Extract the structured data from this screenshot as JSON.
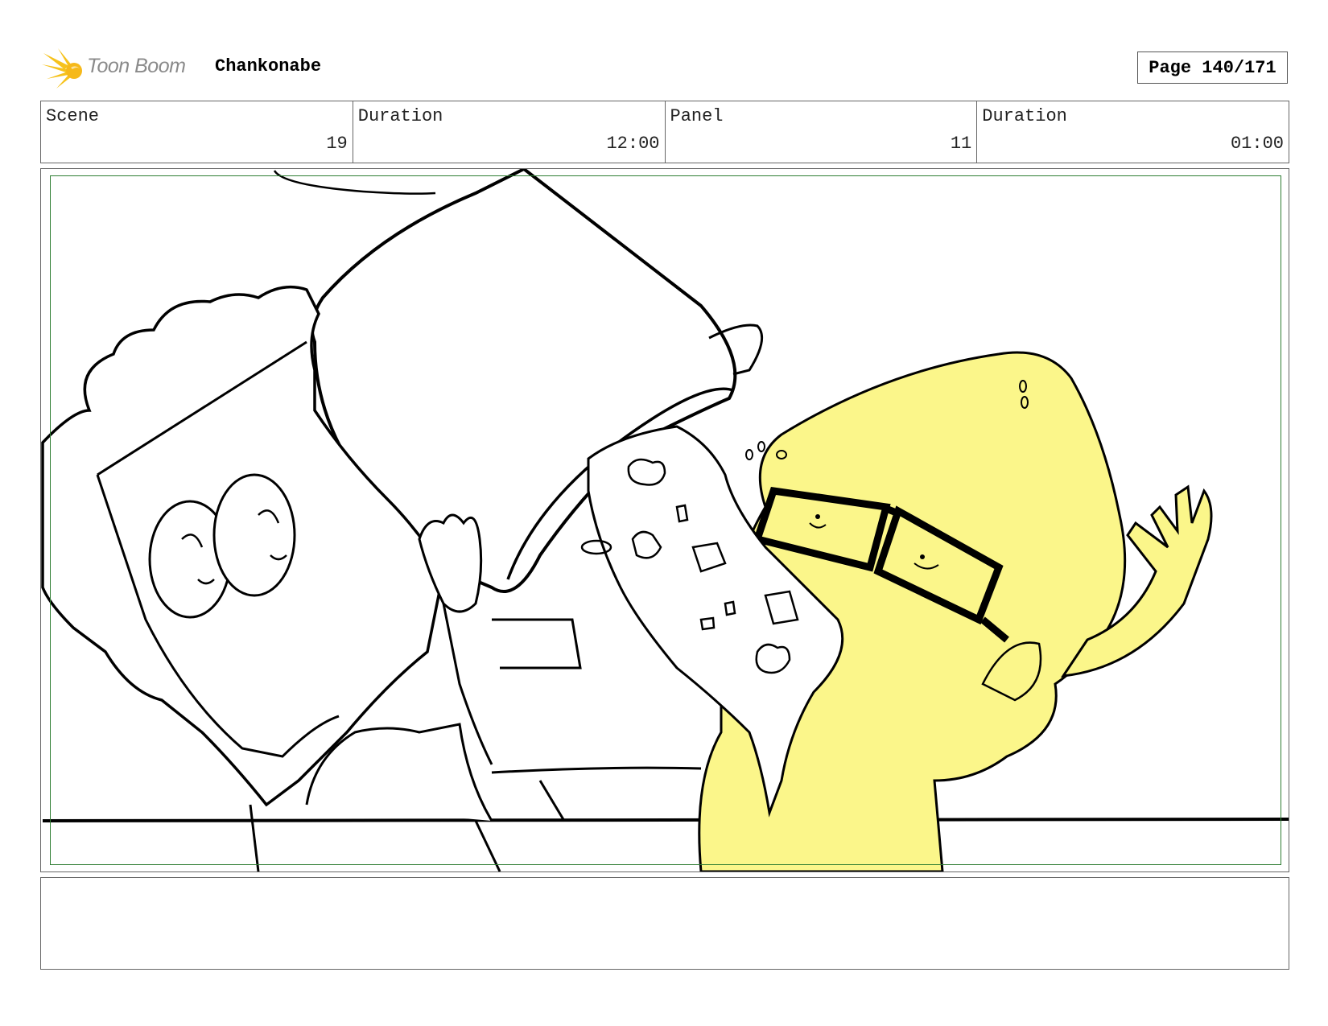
{
  "header": {
    "logo_text": "Toon Boom",
    "logo_icon": "starburst-icon",
    "project_title": "Chankonabe",
    "page_label": "Page 140/171"
  },
  "info": {
    "scene_label": "Scene",
    "scene_value": "19",
    "scene_duration_label": "Duration",
    "scene_duration_value": "12:00",
    "panel_label": "Panel",
    "panel_value": "11",
    "panel_duration_label": "Duration",
    "panel_duration_value": "01:00"
  },
  "panel": {
    "image": "storyboard-sketch",
    "highlight_color": "#fbf68a",
    "safe_frame_color": "#2e7d32"
  },
  "notes": {
    "text": ""
  }
}
